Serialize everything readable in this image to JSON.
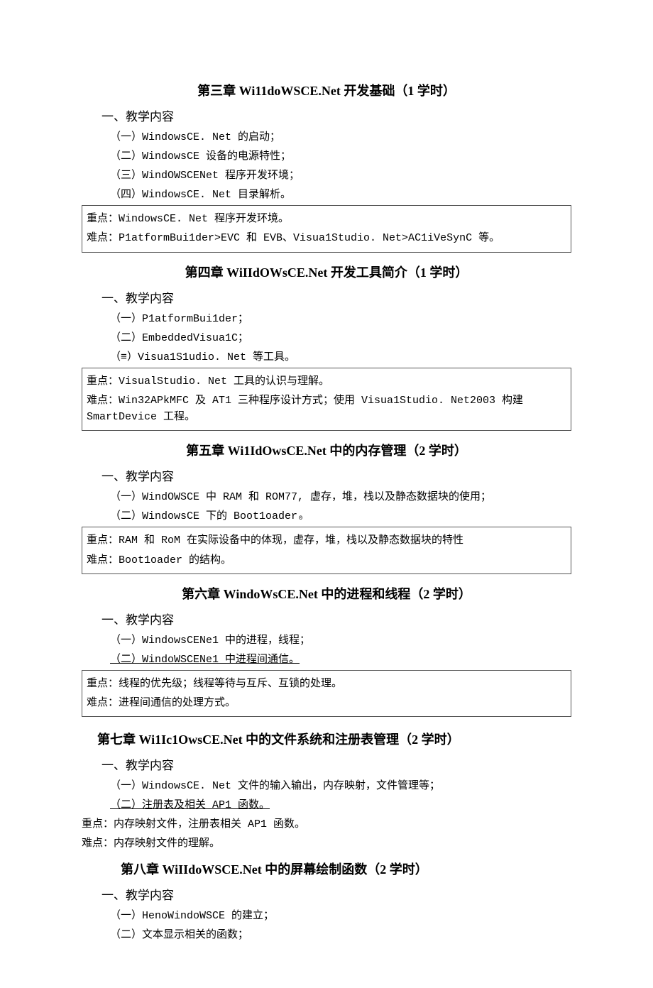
{
  "ch3": {
    "title": "第三章 Wi11doWSCE.Net 开发基础（1 学时）",
    "heading": "一、教学内容",
    "items": [
      "（一）WindowsCE. Net 的启动；",
      "（二）WindowsCE 设备的电源特性；",
      "（三）WindOWSCENet 程序开发环境；",
      "（四）WindowsCE. Net 目录解析。"
    ],
    "box": [
      "重点：WindowsCE. Net 程序开发环境。",
      "难点：P1atformBui1der>EVC 和 EVB、Visua1Studio. Net>AC1iVeSynC 等。"
    ]
  },
  "ch4": {
    "title": "第四章 WiIIdOWsCE.Net 开发工具简介（1 学时）",
    "heading": "一、教学内容",
    "items": [
      "（一）P1atformBui1der；",
      "（二）EmbeddedVisua1C；",
      "（≡）Visua1S1udio. Net 等工具。"
    ],
    "box": [
      "重点：VisualStudio. Net 工具的认识与理解。",
      "难点：Win32APkMFC 及 AT1 三种程序设计方式；使用 Visua1Studio. Net2003 构建 SmartDevice 工程。"
    ]
  },
  "ch5": {
    "title": "第五章 Wi1IdOwsCE.Net 中的内存管理（2 学时）",
    "heading": "一、教学内容",
    "items": [
      "（一）WindOWSCE 中 RAM 和 ROM77, 虚存，堆，栈以及静态数据块的使用；",
      "（二）WindowsCE 下的 Boot1oader₀"
    ],
    "box": [
      "重点：RAM 和 RoM 在实际设备中的体现，虚存，堆，栈以及静态数据块的特性",
      "难点：Boot1oader 的结构。"
    ]
  },
  "ch6": {
    "title": "第六章 WindoWsCE.Net 中的进程和线程（2 学时）",
    "heading": "一、教学内容",
    "items": [
      "（一）WindowsCENe1 中的进程，线程；"
    ],
    "items_u": [
      "（二）WindoWSCENe1 中进程间通信。"
    ],
    "box": [
      "重点：线程的优先级；线程等待与互斥、互锁的处理。",
      "难点：进程间通信的处理方式。"
    ]
  },
  "ch7": {
    "title": "第七章 Wi1Ic1OwsCE.Net 中的文件系统和注册表管理（2 学时）",
    "heading": "一、教学内容",
    "items": [
      "（一）WindowsCE. Net 文件的输入输出，内存映射，文件管理等；"
    ],
    "items_u": [
      "（二）注册表及相关 AP1 函数。"
    ],
    "plain": [
      "重点：内存映射文件，注册表相关 AP1 函数。",
      "难点：内存映射文件的理解。"
    ]
  },
  "ch8": {
    "title": "第八章 WiIIdoWSCE.Net 中的屏幕绘制函数（2 学时）",
    "heading": "一、教学内容",
    "items": [
      "（一）HenoWindoWSCE 的建立；",
      "（二）文本显示相关的函数；"
    ]
  }
}
